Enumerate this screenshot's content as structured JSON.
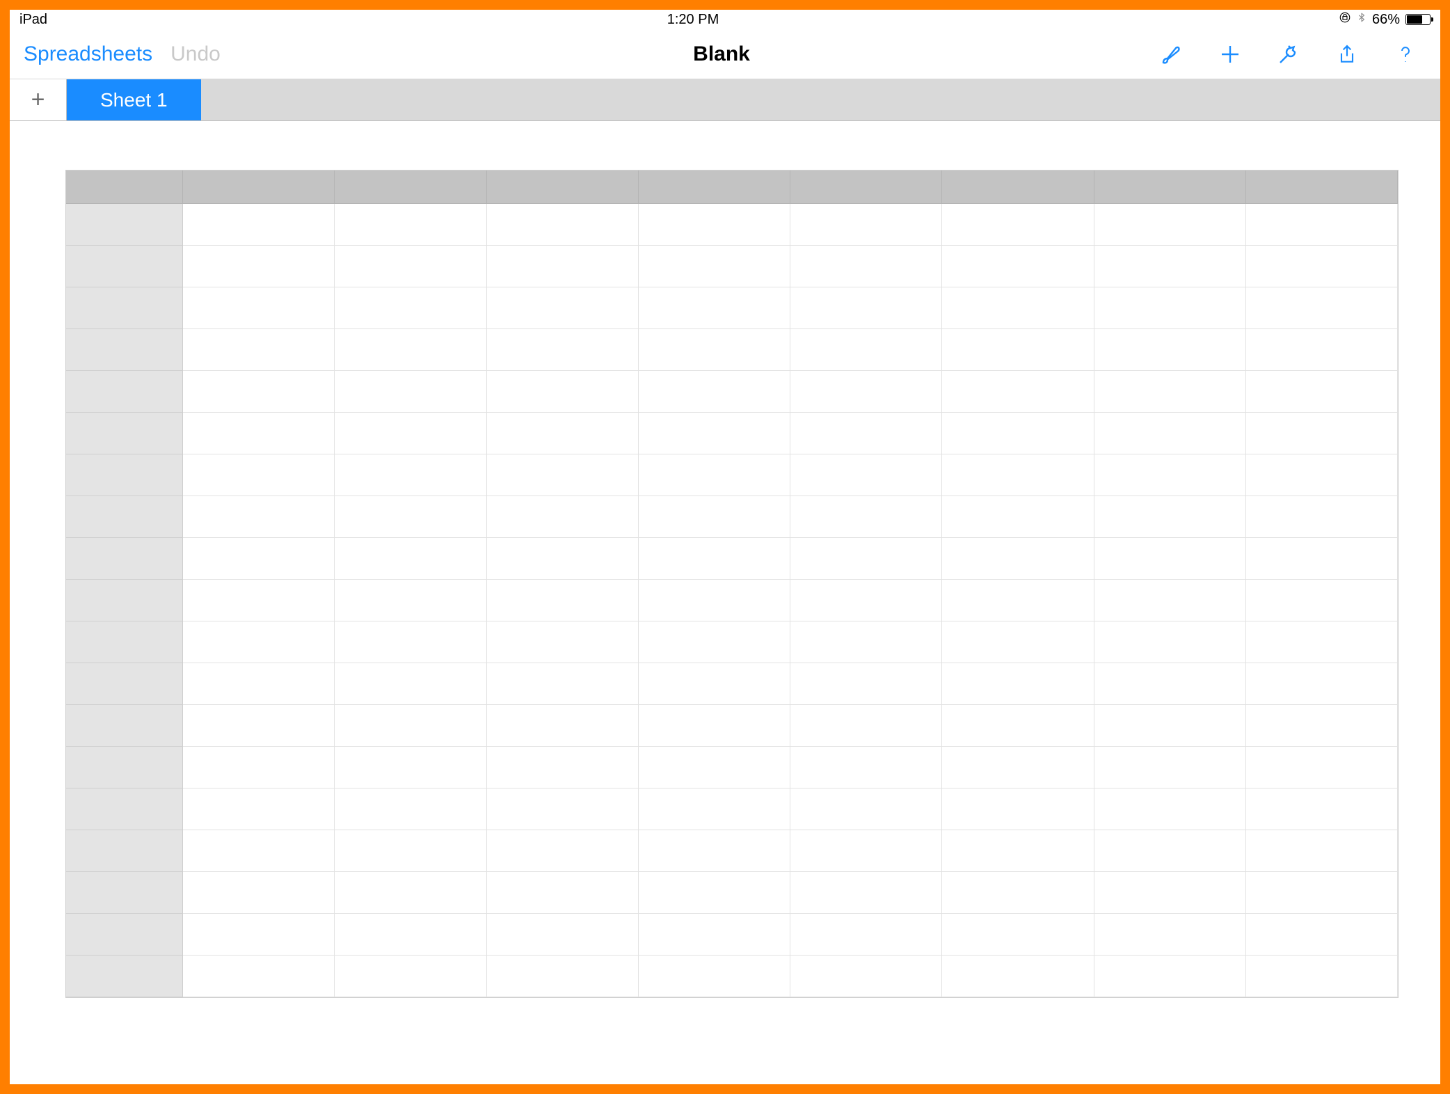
{
  "statusbar": {
    "device": "iPad",
    "time": "1:20 PM",
    "battery_pct": "66%",
    "lock_icon": "orientation-lock",
    "bt_icon": "bluetooth"
  },
  "toolbar": {
    "back_label": "Spreadsheets",
    "undo_label": "Undo",
    "title": "Blank",
    "icons": {
      "format": "paintbrush-icon",
      "add": "plus-icon",
      "tools": "wrench-icon",
      "share": "share-icon",
      "help": "help-icon"
    }
  },
  "tabs": {
    "add_label": "+",
    "items": [
      {
        "label": "Sheet 1",
        "active": true
      }
    ]
  },
  "grid": {
    "columns": 8,
    "rows": 19
  },
  "colors": {
    "accent": "#1a8cff",
    "frame": "#ff7f00",
    "tabbar": "#d9d9d9",
    "colhead": "#c3c3c3",
    "rowhead": "#e4e4e4"
  }
}
